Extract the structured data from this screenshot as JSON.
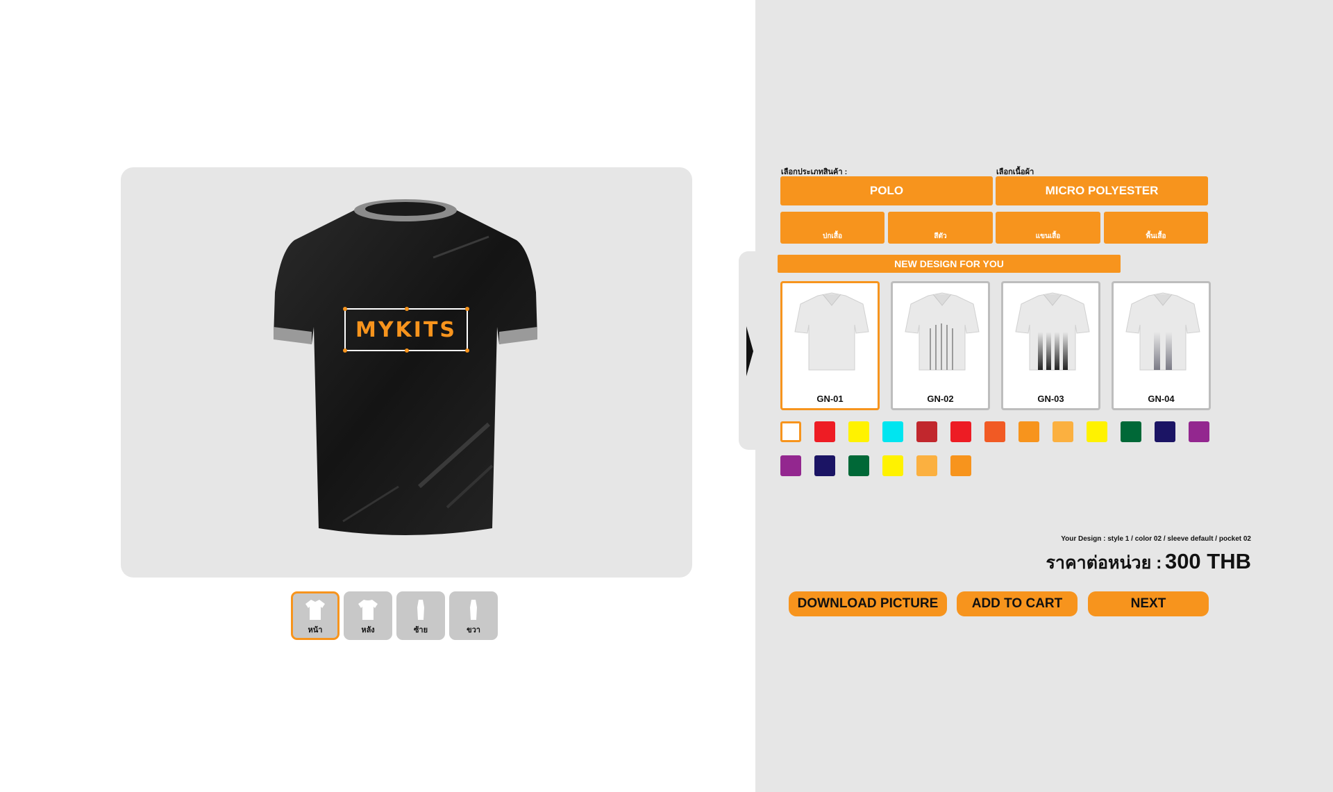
{
  "preview": {
    "logo_text": "MYKITS",
    "views": [
      {
        "label": "หน้า",
        "active": true
      },
      {
        "label": "หลัง",
        "active": false
      },
      {
        "label": "ซ้าย",
        "active": false
      },
      {
        "label": "ขวา",
        "active": false
      }
    ]
  },
  "panel": {
    "product_type_label": "เลือกประเภทสินค้า :",
    "fabric_label": "เลือกเนื้อผ้า",
    "product_type_value": "POLO",
    "fabric_value": "MICRO POLYESTER",
    "sub_options": [
      "ปกเสื้อ",
      "สีตัว",
      "แขนเสื้อ",
      "พื้นเสื้อ"
    ],
    "banner": "NEW DESIGN FOR YOU",
    "designs": [
      {
        "code": "GN-01",
        "selected": true
      },
      {
        "code": "GN-02",
        "selected": false
      },
      {
        "code": "GN-03",
        "selected": false
      },
      {
        "code": "GN-04",
        "selected": false
      }
    ],
    "swatch_colors": [
      "#ffffff",
      "#ee1c24",
      "#fff200",
      "#00e5f0",
      "#c1272d",
      "#ed1c24",
      "#f15a24",
      "#f7941d",
      "#fbb040",
      "#fff200",
      "#006837",
      "#1b1464",
      "#93278f",
      "#93278f",
      "#1b1464",
      "#006837",
      "#fff200",
      "#fbb040",
      "#f7941d"
    ],
    "selected_swatch": 0,
    "design_summary": "Your Design : style 1 / color 02 / sleeve default / pocket 02",
    "price_label": "ราคาต่อหน่วย :",
    "price_value": "300 THB",
    "actions": {
      "download": "DOWNLOAD PICTURE",
      "add_to_cart": "ADD TO CART",
      "next": "NEXT"
    }
  },
  "colors": {
    "accent": "#f7941d",
    "panel_bg": "#e6e6e6"
  }
}
